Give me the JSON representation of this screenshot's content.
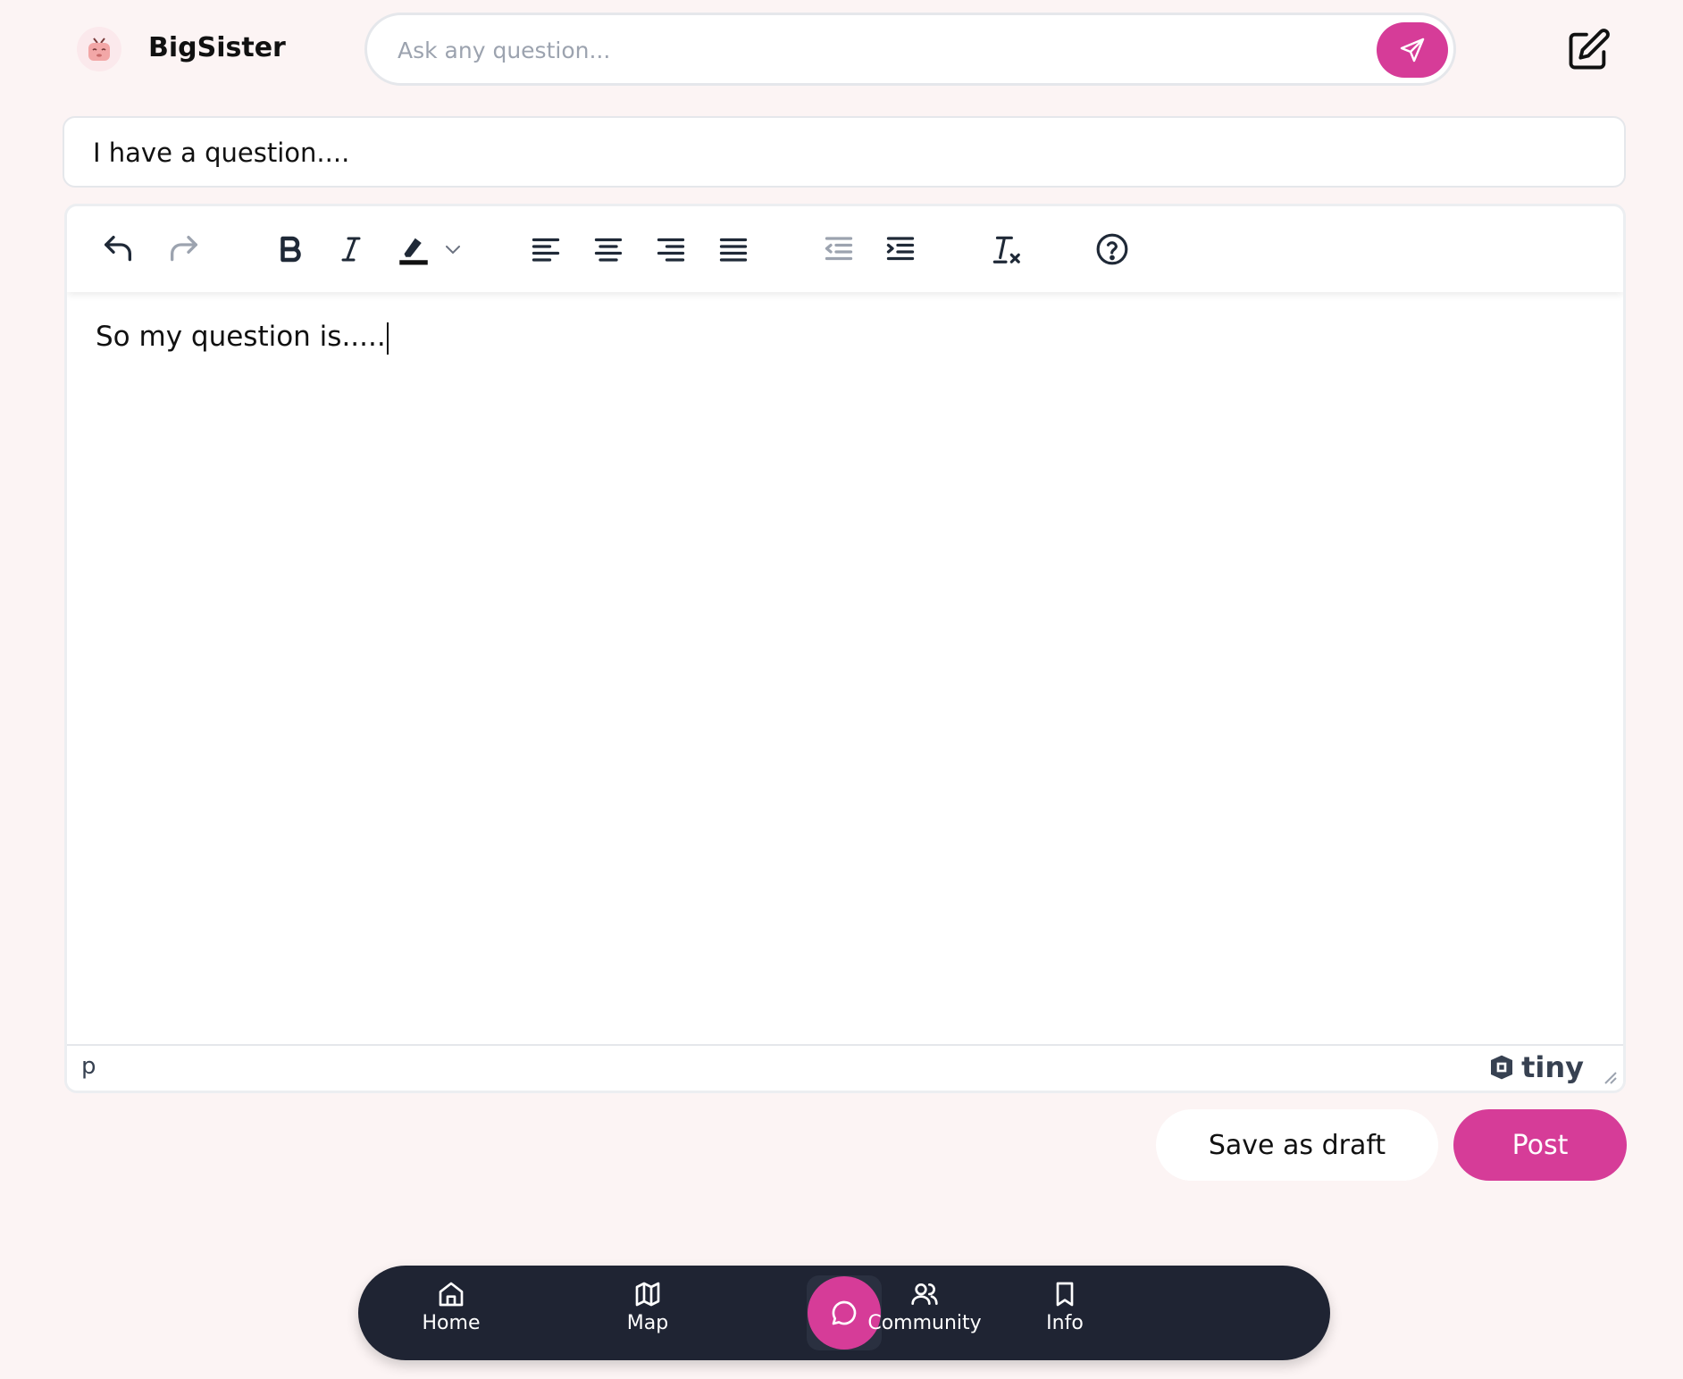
{
  "header": {
    "brand": "BigSister",
    "logo_icon": "bigsister-mascot-icon",
    "search": {
      "placeholder": "Ask any question...",
      "value": ""
    },
    "send_icon": "paper-plane-icon",
    "edit_icon": "edit-square-icon"
  },
  "post": {
    "title_value": "I have a question....",
    "body_text": "So my question is.....",
    "status_path": "p",
    "editor_brand": "tiny"
  },
  "toolbar": {
    "items": [
      "undo",
      "redo",
      "bold",
      "italic",
      "highlight-color",
      "highlight-dropdown",
      "align-left",
      "align-center",
      "align-right",
      "justify",
      "outdent",
      "indent",
      "remove-format",
      "help"
    ]
  },
  "actions": {
    "draft_label": "Save as draft",
    "post_label": "Post"
  },
  "nav": {
    "items": [
      {
        "label": "Home",
        "icon": "home-icon"
      },
      {
        "label": "Map",
        "icon": "map-icon"
      },
      {
        "label": "",
        "icon": "chat-bubble-icon"
      },
      {
        "label": "Community",
        "icon": "users-icon"
      },
      {
        "label": "Info",
        "icon": "bookmark-icon"
      }
    ]
  },
  "colors": {
    "accent": "#d63c98",
    "background": "#fcf4f4",
    "nav_background": "#1f2433"
  }
}
